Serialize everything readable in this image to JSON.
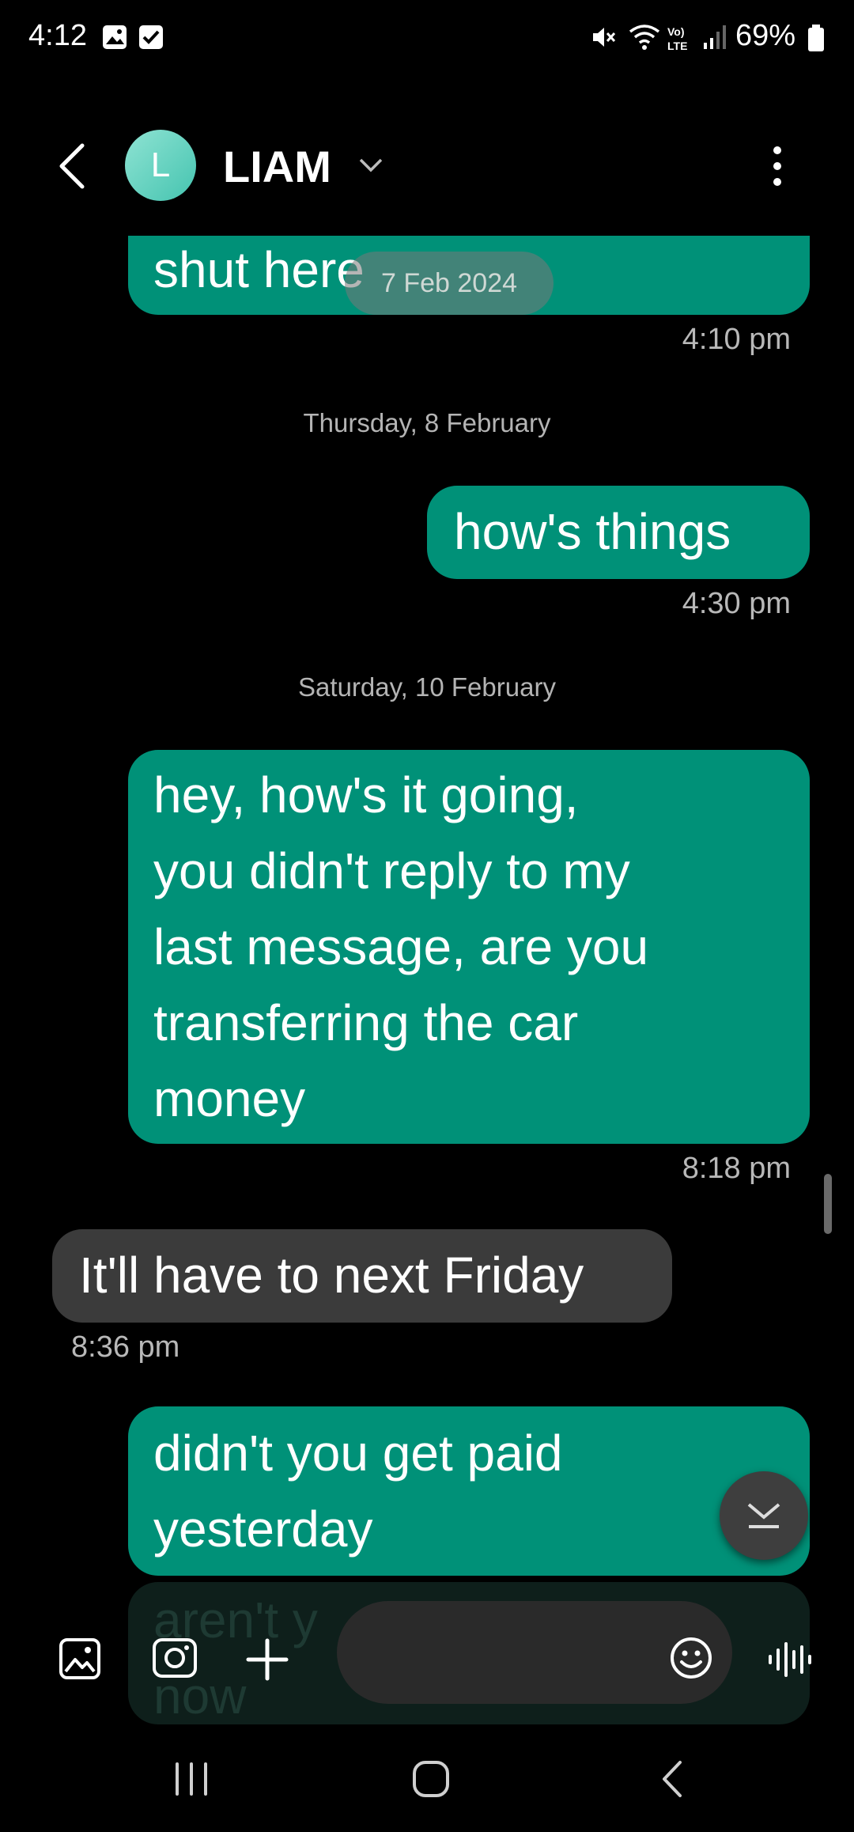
{
  "status_bar": {
    "time": "4:12",
    "battery_percent": "69%",
    "icons": [
      "gallery-notification-icon",
      "checkbox-notification-icon",
      "mute-icon",
      "wifi-icon",
      "volte-icon",
      "signal-icon",
      "battery-icon"
    ]
  },
  "header": {
    "avatar_letter": "L",
    "contact_name": "LIAM"
  },
  "date_pill": "7 Feb 2024",
  "messages": [
    {
      "direction": "out",
      "text": "shut here",
      "time": "4:10 pm"
    },
    {
      "type": "date",
      "text": "Thursday, 8 February"
    },
    {
      "direction": "out",
      "text": "how's things",
      "time": "4:30 pm"
    },
    {
      "type": "date",
      "text": "Saturday, 10 February"
    },
    {
      "direction": "out",
      "lines": [
        "hey, how's it going,",
        "you didn't reply to my",
        "last message, are you",
        "transferring the car",
        "money"
      ],
      "time": "8:18 pm"
    },
    {
      "direction": "in",
      "text": "It'll have to next Friday",
      "time": "8:36 pm"
    },
    {
      "direction": "out",
      "lines": [
        "didn't you get paid",
        "yesterday"
      ]
    },
    {
      "direction": "out",
      "lines": [
        "aren't y",
        "now"
      ],
      "faded": true
    }
  ],
  "colors": {
    "outgoing_bubble": "#009178",
    "incoming_bubble": "#3b3b3b",
    "background": "#000000"
  }
}
